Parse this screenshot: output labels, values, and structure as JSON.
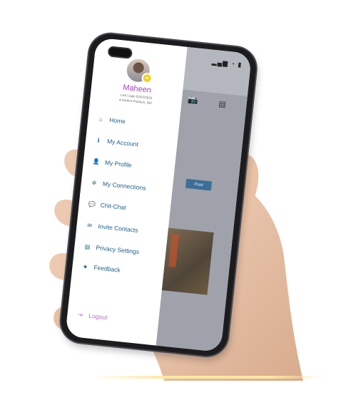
{
  "status_bar": {
    "icons": "▂▄▆ ◔ ▮"
  },
  "drawer": {
    "user": {
      "name": "Maheen",
      "last_login": "Last Login 02/02/2023",
      "location": "Andhra Pradesh, IND"
    },
    "items": [
      {
        "label": "Home",
        "icon": "home-icon",
        "glyph": "⌂"
      },
      {
        "label": "My Account",
        "icon": "info-icon",
        "glyph": "ℹ"
      },
      {
        "label": "My Profile",
        "icon": "person-icon",
        "glyph": "👤"
      },
      {
        "label": "My Connections",
        "icon": "connections-icon",
        "glyph": "✲"
      },
      {
        "label": "Chit-Chat",
        "icon": "chat-icon",
        "glyph": "💬"
      },
      {
        "label": "Invite Contacts",
        "icon": "envelope-icon",
        "glyph": "✉"
      },
      {
        "label": "Privacy Settings",
        "icon": "privacy-icon",
        "glyph": "▤"
      },
      {
        "label": "Feedback",
        "icon": "star-icon",
        "glyph": "★"
      }
    ],
    "logout": {
      "label": "Logout",
      "icon": "logout-icon",
      "glyph": "⇥"
    }
  },
  "background_app": {
    "post_button": "Post"
  },
  "colors": {
    "accent_purple": "#a145bc",
    "menu_blue": "#1f5f8b",
    "logout_purple": "#b46fcb",
    "post_blue": "#3c6e98"
  }
}
